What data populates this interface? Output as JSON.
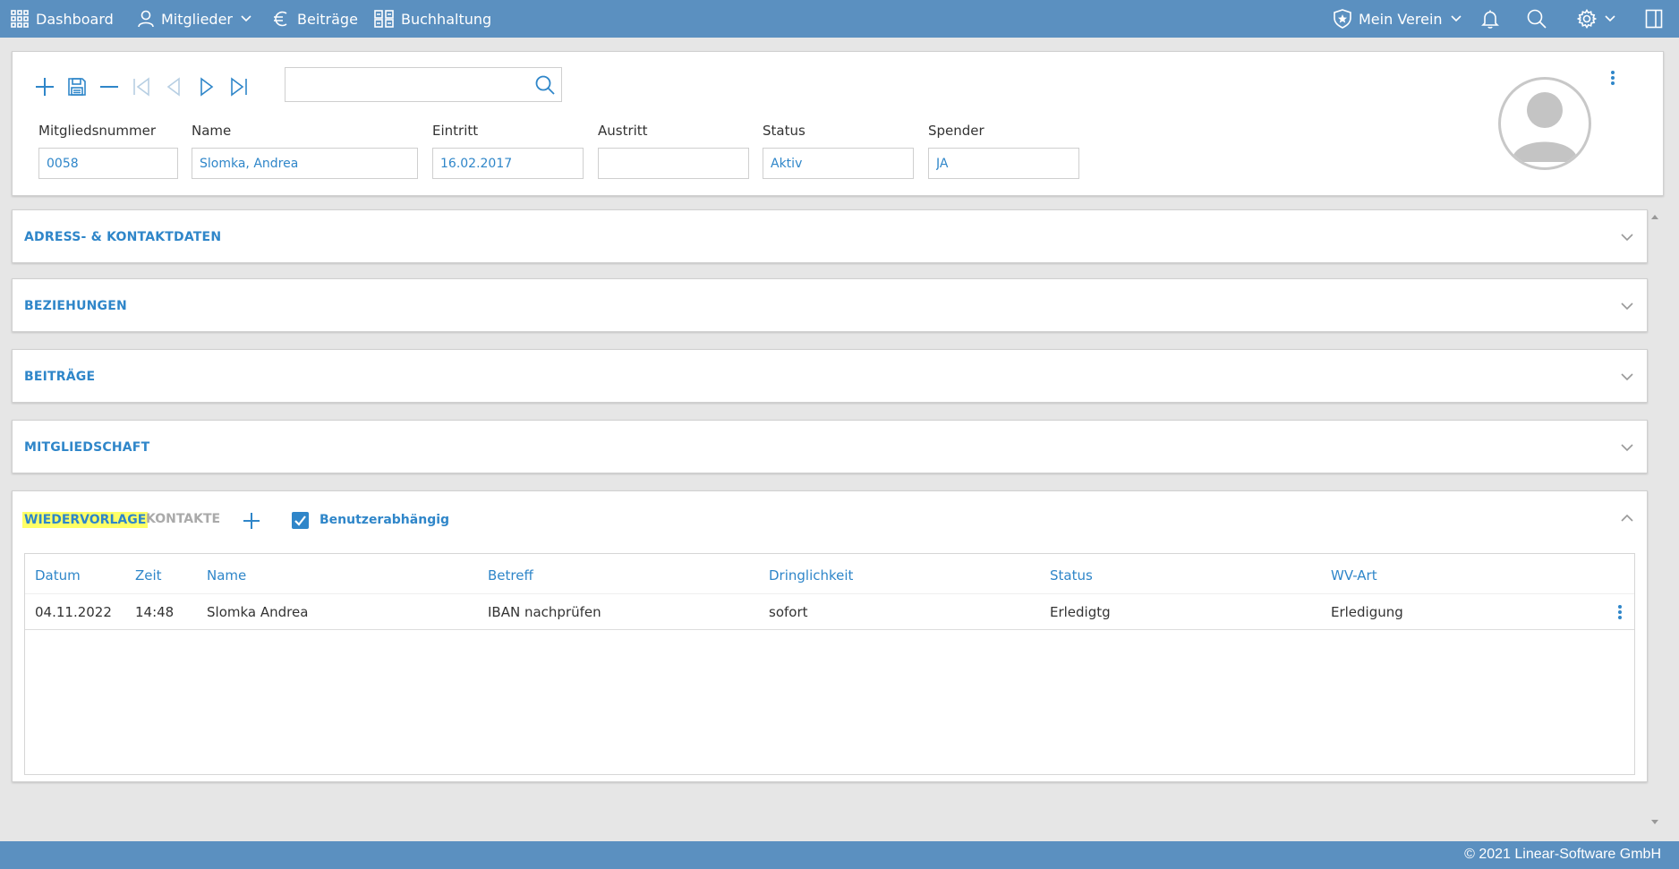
{
  "nav": {
    "dashboard": "Dashboard",
    "members": "Mitglieder",
    "contributions": "Beiträge",
    "accounting": "Buchhaltung",
    "club": "Mein Verein"
  },
  "icons": {
    "dashboard": "grid-icon",
    "members": "user-icon",
    "contributions": "euro-icon",
    "accounting": "ledger-icon",
    "club": "shield-star-icon",
    "notifications": "bell-icon",
    "search": "search-icon",
    "settings": "gear-icon",
    "panel": "sidebar-panel-icon"
  },
  "colors": {
    "primary": "#5b90c0",
    "accent": "#2f86c9",
    "highlight": "#ffff66"
  },
  "member": {
    "fields": [
      {
        "label": "Mitgliedsnummer",
        "value": "0058"
      },
      {
        "label": "Name",
        "value": "Slomka, Andrea"
      },
      {
        "label": "Eintritt",
        "value": "16.02.2017"
      },
      {
        "label": "Austritt",
        "value": ""
      },
      {
        "label": "Status",
        "value": "Aktiv"
      },
      {
        "label": "Spender",
        "value": "JA"
      }
    ]
  },
  "sections": [
    "ADRESS- & KONTAKTDATEN",
    "BEZIEHUNGEN",
    "BEITRÄGE",
    "MITGLIEDSCHAFT"
  ],
  "followup": {
    "tabs": [
      "WIEDERVORLAGE",
      "KONTAKTE"
    ],
    "checkbox_label": "Benutzerabhängig",
    "checkbox_checked": true,
    "columns": [
      "Datum",
      "Zeit",
      "Name",
      "Betreff",
      "Dringlichkeit",
      "Status",
      "WV-Art"
    ],
    "rows": [
      [
        "04.11.2022",
        "14:48",
        "Slomka Andrea",
        "IBAN nachprüfen",
        "sofort",
        "Erledigtg",
        "Erledigung"
      ]
    ]
  },
  "footer": "© 2021 Linear-Software GmbH"
}
